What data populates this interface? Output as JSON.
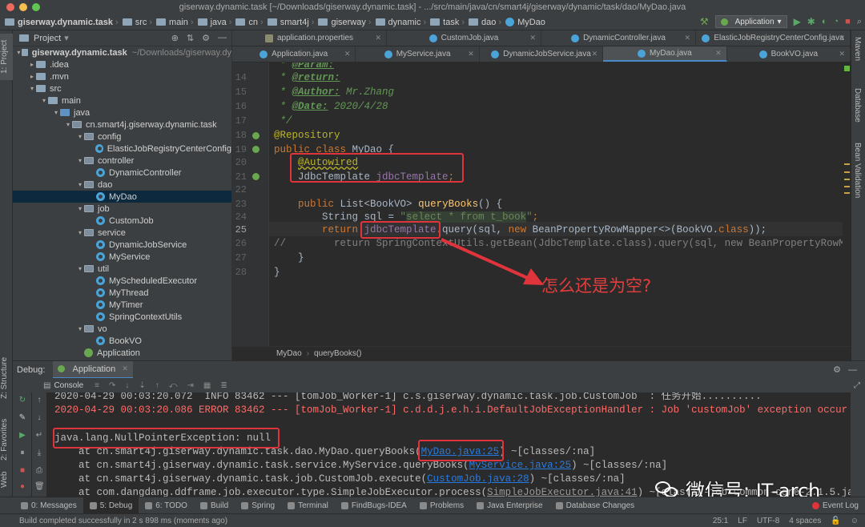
{
  "window": {
    "title": "giserway.dynamic.task [~/Downloads/giserway.dynamic.task] - .../src/main/java/cn/smart4j/giserway/dynamic/task/dao/MyDao.java"
  },
  "navbar": {
    "crumbs": [
      "giserway.dynamic.task",
      "src",
      "main",
      "java",
      "cn",
      "smart4j",
      "giserway",
      "dynamic",
      "task",
      "dao",
      "MyDao"
    ],
    "run_config": "Application"
  },
  "left_tool": {
    "project_tab": "1: Project",
    "structure_tab": "Z: Structure",
    "favorites_tab": "2: Favorites",
    "web_tab": "Web"
  },
  "right_tool": {
    "maven": "Maven",
    "database": "Database",
    "bean_validation": "Bean Validation"
  },
  "project": {
    "header": "Project",
    "tree": [
      {
        "label": "giserway.dynamic.task",
        "extra": "~/Downloads/giserway.dy",
        "icon": "folder-icon",
        "depth": 0,
        "open": true,
        "bold": true
      },
      {
        "label": ".idea",
        "icon": "folder-icon",
        "depth": 1,
        "open": false
      },
      {
        "label": ".mvn",
        "icon": "folder-icon",
        "depth": 1,
        "open": false
      },
      {
        "label": "src",
        "icon": "folder-icon",
        "depth": 1,
        "open": true
      },
      {
        "label": "main",
        "icon": "folder-icon",
        "depth": 2,
        "open": true
      },
      {
        "label": "java",
        "icon": "source-folder-icon",
        "depth": 3,
        "open": true
      },
      {
        "label": "cn.smart4j.giserway.dynamic.task",
        "icon": "package-icon",
        "depth": 4,
        "open": true
      },
      {
        "label": "config",
        "icon": "package-icon",
        "depth": 5,
        "open": true
      },
      {
        "label": "ElasticJobRegistryCenterConfig",
        "icon": "class-icon",
        "depth": 6
      },
      {
        "label": "controller",
        "icon": "package-icon",
        "depth": 5,
        "open": true
      },
      {
        "label": "DynamicController",
        "icon": "class-icon",
        "depth": 6
      },
      {
        "label": "dao",
        "icon": "package-icon",
        "depth": 5,
        "open": true
      },
      {
        "label": "MyDao",
        "icon": "class-icon",
        "depth": 6,
        "selected": true
      },
      {
        "label": "job",
        "icon": "package-icon",
        "depth": 5,
        "open": true
      },
      {
        "label": "CustomJob",
        "icon": "class-icon",
        "depth": 6
      },
      {
        "label": "service",
        "icon": "package-icon",
        "depth": 5,
        "open": true
      },
      {
        "label": "DynamicJobService",
        "icon": "class-icon",
        "depth": 6
      },
      {
        "label": "MyService",
        "icon": "class-icon",
        "depth": 6
      },
      {
        "label": "util",
        "icon": "package-icon",
        "depth": 5,
        "open": true
      },
      {
        "label": "MyScheduledExecutor",
        "icon": "class-icon",
        "depth": 6
      },
      {
        "label": "MyThread",
        "icon": "class-icon",
        "depth": 6
      },
      {
        "label": "MyTimer",
        "icon": "class-icon",
        "depth": 6
      },
      {
        "label": "SpringContextUtils",
        "icon": "class-icon",
        "depth": 6
      },
      {
        "label": "vo",
        "icon": "package-icon",
        "depth": 5,
        "open": true
      },
      {
        "label": "BookVO",
        "icon": "class-icon",
        "depth": 6
      },
      {
        "label": "Application",
        "icon": "spring-class-icon",
        "depth": 5
      }
    ]
  },
  "editor_tabs": {
    "row1": [
      {
        "label": "application.properties",
        "icon": "properties-icon"
      },
      {
        "label": "CustomJob.java",
        "icon": "class-icon"
      },
      {
        "label": "DynamicController.java",
        "icon": "class-icon"
      },
      {
        "label": "ElasticJobRegistryCenterConfig.java",
        "icon": "class-icon"
      }
    ],
    "row2": [
      {
        "label": "Application.java",
        "icon": "class-icon"
      },
      {
        "label": "MyService.java",
        "icon": "class-icon"
      },
      {
        "label": "DynamicJobService.java",
        "icon": "class-icon"
      },
      {
        "label": "MyDao.java",
        "icon": "class-icon",
        "active": true
      },
      {
        "label": "BookVO.java",
        "icon": "class-icon"
      }
    ]
  },
  "editor": {
    "line_numbers": [
      "14",
      "15",
      "16",
      "17",
      "18",
      "19",
      "20",
      "21",
      "22",
      "23",
      "24",
      "25",
      "26",
      "27",
      "28"
    ],
    "current_line": "25",
    "lines": {
      "l13": [
        "* ",
        "@Param:"
      ],
      "l14": [
        "* ",
        "@return:"
      ],
      "l15": [
        "* ",
        "@Author:",
        " Mr.Zhang"
      ],
      "l16": [
        "* ",
        "@Date:",
        " 2020/4/28"
      ],
      "l17": "*/",
      "l18": "@Repository",
      "l19": [
        "public class ",
        "MyDao {"
      ],
      "l20": "@Autowired",
      "l21": [
        "JdbcTemplate ",
        "jdbcTemplate",
        ";"
      ],
      "l23": [
        "public ",
        "List<BookVO> ",
        "queryBooks",
        "() {"
      ],
      "l24": [
        "String sql = ",
        "\"",
        "select * from t_book",
        "\"",
        ";"
      ],
      "l25": [
        "return ",
        "jdbcTemplate",
        ".query(sql, ",
        "new ",
        "BeanPropertyRowMapper<>(BookVO.",
        "class",
        "));"
      ],
      "l26": [
        "//",
        "        return SpringContextUtils.getBean(JdbcTemplate.class).query(sql, new BeanPropertyRowMa"
      ],
      "l27": "}",
      "l28": "}"
    },
    "breadcrumb": [
      "MyDao",
      "queryBooks()"
    ],
    "annotation": "怎么还是为空?"
  },
  "debug": {
    "label": "Debug:",
    "config_tab": "Application",
    "console_tab": "Console",
    "lines": {
      "c0": "2020-04-29 00:03:20.072  INFO 83462 --- [tomJob_Worker-1] c.s.giserway.dynamic.task.job.CustomJob  : 任务开始..........",
      "c1": "2020-04-29 00:03:20.086 ERROR 83462 --- [tomJob_Worker-1] c.d.d.j.e.h.i.DefaultJobExceptionHandler : Job 'customJob' exception occur",
      "c3": "java.lang.NullPointerException: null",
      "c4": [
        "    at cn.smart4j.giserway.dynamic.task.dao.MyDao.queryBooks(",
        "MyDao.java:25",
        ") ~[classes/:na]"
      ],
      "c5": [
        "    at cn.smart4j.giserway.dynamic.task.service.MyService.queryBooks(",
        "MyService.java:25",
        ") ~[classes/:na]"
      ],
      "c6": [
        "    at cn.smart4j.giserway.dynamic.task.job.CustomJob.execute(",
        "CustomJob.java:28",
        ") ~[classes/:na]"
      ],
      "c7": [
        "    at com.dangdang.ddframe.job.executor.type.SimpleJobExecutor.process(",
        "SimpleJobExecutor.java:41",
        ") ~[elastic-job-common-core-2.1.5.ja"
      ]
    }
  },
  "bottom_tabs": [
    {
      "label": "0: Messages"
    },
    {
      "label": "5: Debug",
      "active": true
    },
    {
      "label": "6: TODO"
    },
    {
      "label": "Build"
    },
    {
      "label": "Spring"
    },
    {
      "label": "Terminal"
    },
    {
      "label": "FindBugs-IDEA"
    },
    {
      "label": "Problems"
    },
    {
      "label": "Java Enterprise"
    },
    {
      "label": "Database Changes"
    }
  ],
  "event_log": "Event Log",
  "status": {
    "message": "Build completed successfully in 2 s 898 ms (moments ago)",
    "position": "25:1",
    "line_sep": "LF",
    "encoding": "UTF-8",
    "indent": "4 spaces"
  },
  "watermark": "微信号: IT-arch",
  "colors": {
    "error_red": "#ff6b68",
    "box_red": "#e0343c",
    "link_blue": "#287bde",
    "keyword": "#cc7832",
    "annotation": "#bbb529",
    "field": "#9876aa",
    "comment": "#629755"
  }
}
